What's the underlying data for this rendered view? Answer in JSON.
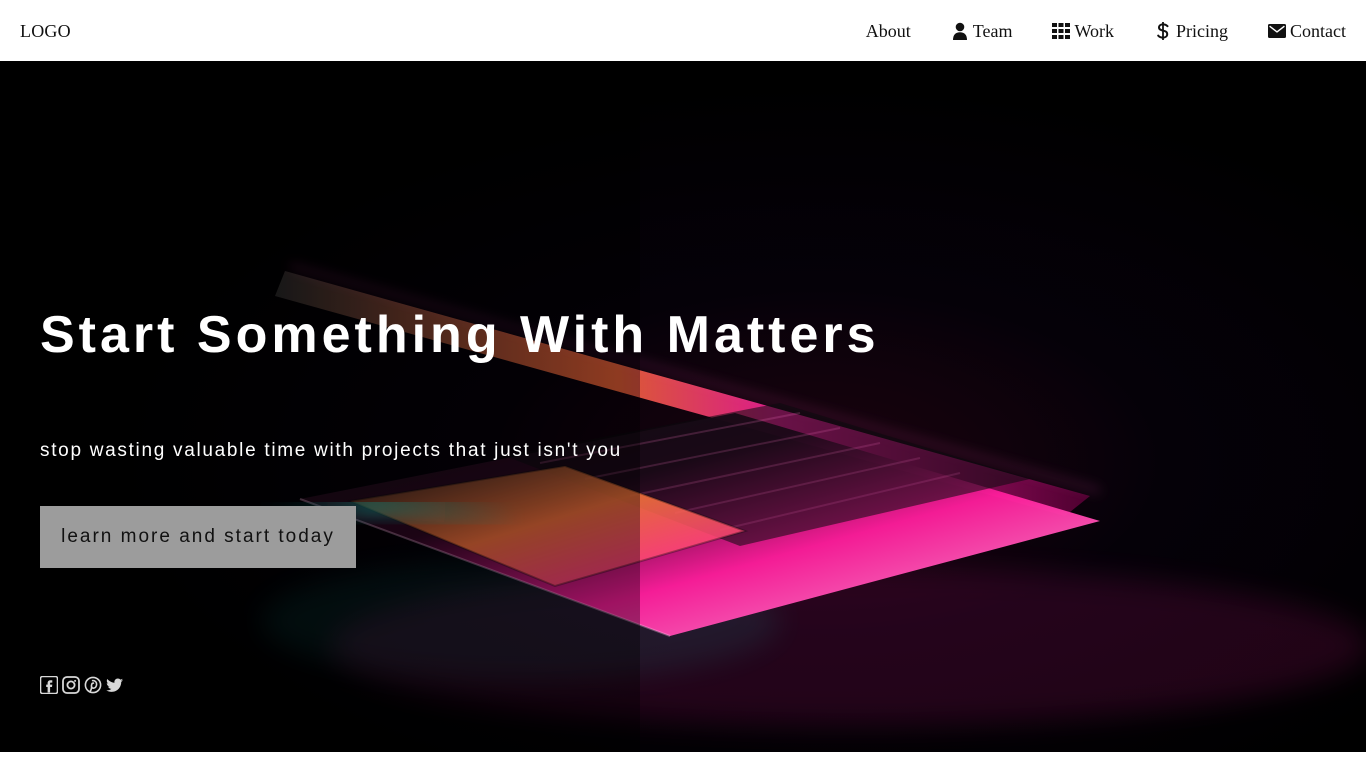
{
  "header": {
    "logo": "LOGO",
    "nav": [
      {
        "id": "about",
        "label": "About",
        "icon": null
      },
      {
        "id": "team",
        "label": "Team",
        "icon": "user-icon"
      },
      {
        "id": "work",
        "label": "Work",
        "icon": "grid-icon"
      },
      {
        "id": "pricing",
        "label": "Pricing",
        "icon": "dollar-icon"
      },
      {
        "id": "contact",
        "label": "Contact",
        "icon": "envelope-icon"
      }
    ]
  },
  "hero": {
    "title": "Start Something With Matters",
    "subtitle": "stop wasting valuable time with projects that just isn't you",
    "cta_label": "learn more and start today",
    "socials": [
      {
        "id": "facebook",
        "icon": "facebook-icon"
      },
      {
        "id": "instagram",
        "icon": "instagram-icon"
      },
      {
        "id": "pinterest",
        "icon": "pinterest-icon"
      },
      {
        "id": "twitter",
        "icon": "twitter-icon"
      }
    ]
  },
  "colors": {
    "nav_bg": "#ffffff",
    "nav_text": "#111111",
    "hero_bg": "#000000",
    "hero_text": "#ffffff",
    "cta_bg": "#9c9c9c",
    "cta_text": "#111111",
    "social_icon": "#d8d8d8",
    "laptop_glow_pink": "#ff1fa2",
    "laptop_glow_orange": "#ff7a3a",
    "laptop_glow_teal": "#18c6b6"
  }
}
